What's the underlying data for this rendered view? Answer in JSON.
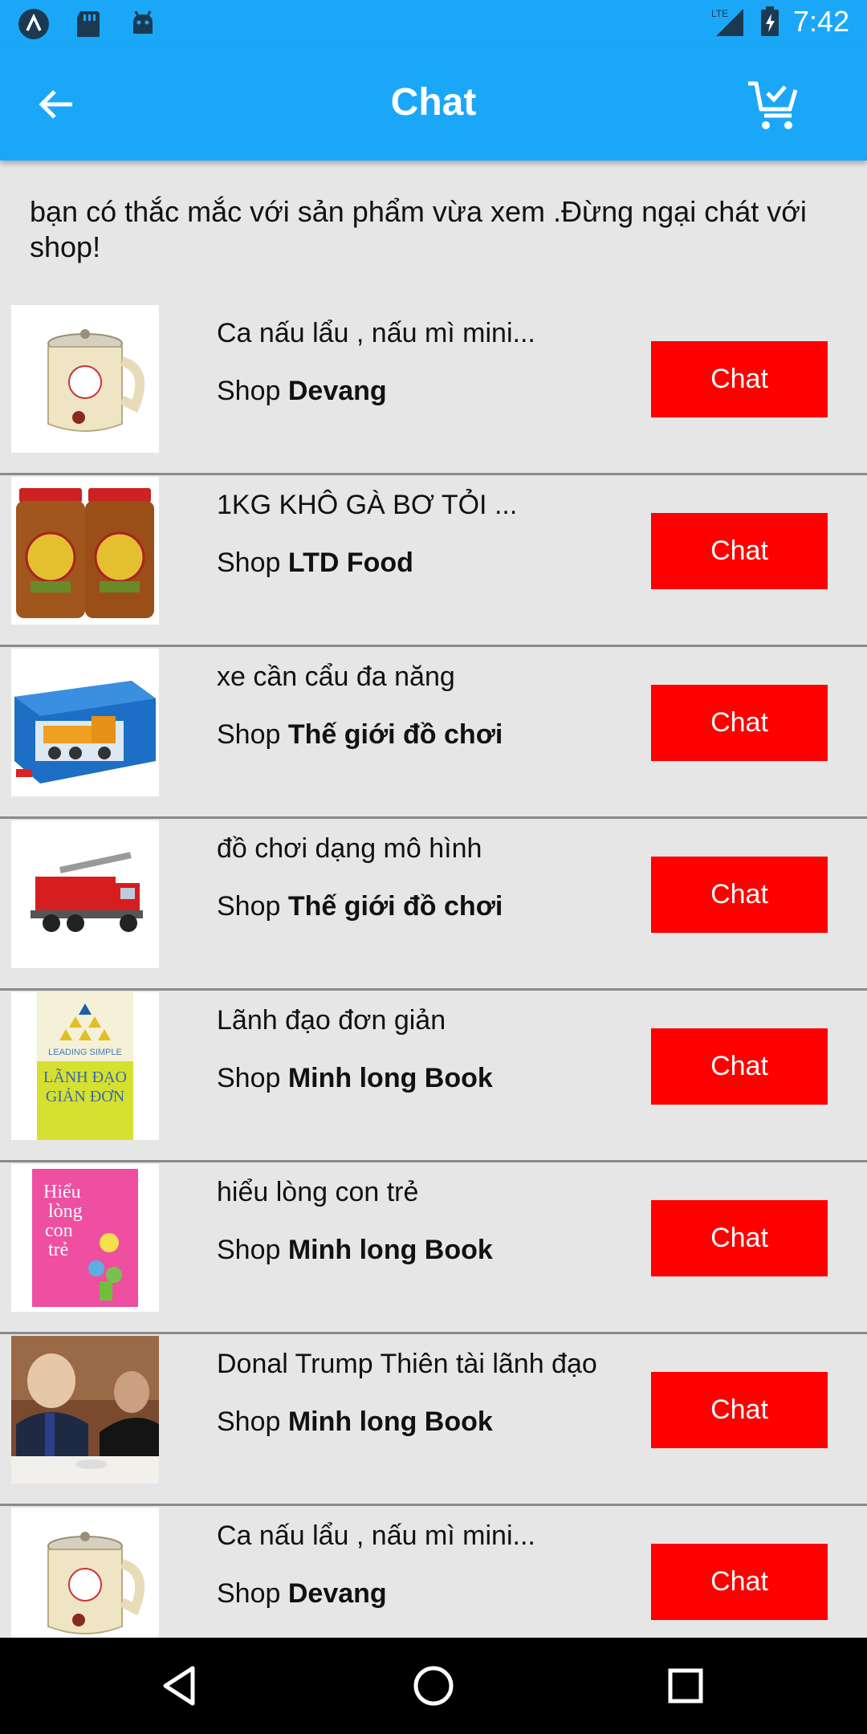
{
  "status_bar": {
    "network": "LTE",
    "time": "7:42",
    "icons": [
      "app-a-icon",
      "sd-card-icon",
      "android-icon",
      "lte-signal-icon",
      "battery-charging-icon"
    ]
  },
  "header": {
    "title": "Chat",
    "back_icon": "arrow-left-icon",
    "cart_icon": "cart-check-icon"
  },
  "intro_text": "bạn có thắc mắc với sản phẩm vừa xem .Đừng ngại chát với shop!",
  "items": [
    {
      "name": "Ca nấu lẩu , nấu mì mini...",
      "shop_prefix": "Shop",
      "shop": "Devang",
      "chat_label": "Chat",
      "thumb": "pot"
    },
    {
      "name": "1KG KHÔ GÀ BƠ TỎI ...",
      "shop_prefix": "Shop",
      "shop": "LTD Food",
      "chat_label": "Chat",
      "thumb": "jars"
    },
    {
      "name": "xe cần cẩu đa năng",
      "shop_prefix": "Shop",
      "shop": "Thế giới đồ chơi",
      "chat_label": "Chat",
      "thumb": "crane"
    },
    {
      "name": "đồ chơi dạng mô hình",
      "shop_prefix": "Shop",
      "shop": "Thế giới đồ chơi",
      "chat_label": "Chat",
      "thumb": "firetruck"
    },
    {
      "name": "Lãnh đạo đơn giản",
      "shop_prefix": "Shop",
      "shop": "Minh long Book",
      "chat_label": "Chat",
      "thumb": "book-yellow"
    },
    {
      "name": "hiểu lòng con trẻ",
      "shop_prefix": "Shop",
      "shop": "Minh long Book",
      "chat_label": "Chat",
      "thumb": "book-pink"
    },
    {
      "name": "Donal Trump Thiên tài lãnh đạo",
      "shop_prefix": "Shop",
      "shop": "Minh long Book",
      "chat_label": "Chat",
      "thumb": "photo"
    },
    {
      "name": "Ca nấu lẩu , nấu mì mini...",
      "shop_prefix": "Shop",
      "shop": "Devang",
      "chat_label": "Chat",
      "thumb": "pot"
    }
  ],
  "thumb_text": {
    "book_yellow_top": "LEADING SIMPLE",
    "book_yellow_title1": "LÃNH ĐẠO",
    "book_yellow_title2": "GIẢN ĐƠN",
    "book_pink_title1": "Hiểu",
    "book_pink_title2": "lòng",
    "book_pink_title3": "con",
    "book_pink_title4": "trẻ"
  },
  "nav": {
    "back_icon": "nav-back-icon",
    "home_icon": "nav-home-icon",
    "recents_icon": "nav-recents-icon"
  },
  "colors": {
    "primary": "#1ba7f7",
    "chat_button": "#fe0000",
    "background": "#e6e6e6"
  }
}
